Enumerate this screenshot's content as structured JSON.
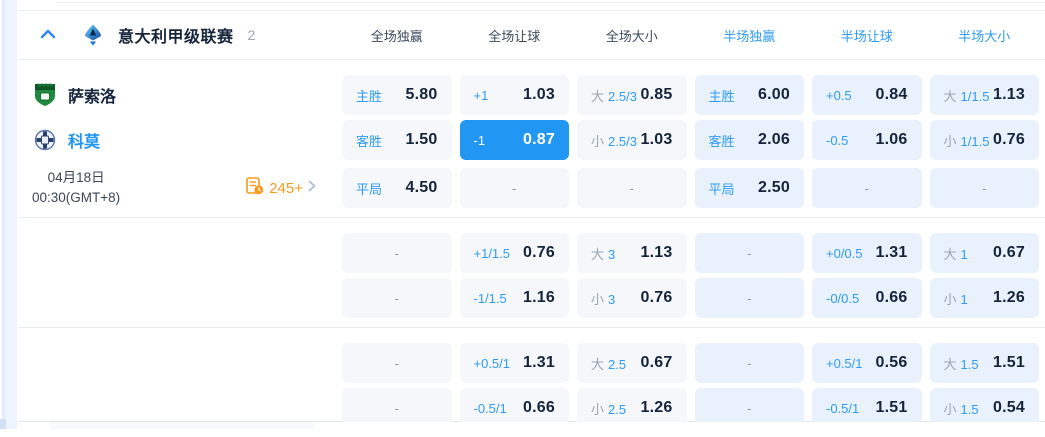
{
  "colors": {
    "accent_blue": "#2196f3",
    "label_blue": "#2f9bf4",
    "full_cell_bg": "#f5f7fa",
    "half_cell_bg": "#e9f2fc",
    "markets_orange": "#f89a1e",
    "value_dark": "#15243b"
  },
  "header": {
    "league": "意大利甲级联赛",
    "count": "2",
    "columns": [
      {
        "label": "全场独赢",
        "scope": "full"
      },
      {
        "label": "全场让球",
        "scope": "full"
      },
      {
        "label": "全场大小",
        "scope": "full"
      },
      {
        "label": "半场独赢",
        "scope": "half"
      },
      {
        "label": "半场让球",
        "scope": "half"
      },
      {
        "label": "半场大小",
        "scope": "half"
      }
    ]
  },
  "match": {
    "home": "萨索洛",
    "away": "科莫",
    "date_line1": "04月18日",
    "date_line2": "00:30(GMT+8)",
    "more_markets": "245+"
  },
  "odds": {
    "groups": [
      {
        "rows": [
          [
            {
              "t": "odds",
              "label": "主胜",
              "value": "5.80"
            },
            {
              "t": "odds",
              "label": "+1",
              "value": "1.03"
            },
            {
              "t": "ou",
              "side": "大",
              "line": "2.5/3",
              "value": "0.85"
            },
            {
              "t": "odds",
              "label": "主胜",
              "value": "6.00"
            },
            {
              "t": "odds",
              "label": "+0.5",
              "value": "0.84"
            },
            {
              "t": "ou",
              "side": "大",
              "line": "1/1.5",
              "value": "1.13"
            }
          ],
          [
            {
              "t": "odds",
              "label": "客胜",
              "value": "1.50"
            },
            {
              "t": "odds",
              "label": "-1",
              "value": "0.87",
              "hl": true
            },
            {
              "t": "ou",
              "side": "小",
              "line": "2.5/3",
              "value": "1.03"
            },
            {
              "t": "odds",
              "label": "客胜",
              "value": "2.06"
            },
            {
              "t": "odds",
              "label": "-0.5",
              "value": "1.06"
            },
            {
              "t": "ou",
              "side": "小",
              "line": "1/1.5",
              "value": "0.76"
            }
          ],
          [
            {
              "t": "odds",
              "label": "平局",
              "value": "4.50"
            },
            {
              "t": "dash"
            },
            {
              "t": "dash"
            },
            {
              "t": "odds",
              "label": "平局",
              "value": "2.50"
            },
            {
              "t": "dash"
            },
            {
              "t": "dash"
            }
          ]
        ]
      },
      {
        "rows": [
          [
            {
              "t": "dash"
            },
            {
              "t": "odds",
              "label": "+1/1.5",
              "value": "0.76"
            },
            {
              "t": "ou",
              "side": "大",
              "line": "3",
              "value": "1.13"
            },
            {
              "t": "dash"
            },
            {
              "t": "odds",
              "label": "+0/0.5",
              "value": "1.31"
            },
            {
              "t": "ou",
              "side": "大",
              "line": "1",
              "value": "0.67"
            }
          ],
          [
            {
              "t": "dash"
            },
            {
              "t": "odds",
              "label": "-1/1.5",
              "value": "1.16"
            },
            {
              "t": "ou",
              "side": "小",
              "line": "3",
              "value": "0.76"
            },
            {
              "t": "dash"
            },
            {
              "t": "odds",
              "label": "-0/0.5",
              "value": "0.66"
            },
            {
              "t": "ou",
              "side": "小",
              "line": "1",
              "value": "1.26"
            }
          ]
        ]
      },
      {
        "rows": [
          [
            {
              "t": "dash"
            },
            {
              "t": "odds",
              "label": "+0.5/1",
              "value": "1.31"
            },
            {
              "t": "ou",
              "side": "大",
              "line": "2.5",
              "value": "0.67"
            },
            {
              "t": "dash"
            },
            {
              "t": "odds",
              "label": "+0.5/1",
              "value": "0.56"
            },
            {
              "t": "ou",
              "side": "大",
              "line": "1.5",
              "value": "1.51"
            }
          ],
          [
            {
              "t": "dash"
            },
            {
              "t": "odds",
              "label": "-0.5/1",
              "value": "0.66"
            },
            {
              "t": "ou",
              "side": "小",
              "line": "2.5",
              "value": "1.26"
            },
            {
              "t": "dash"
            },
            {
              "t": "odds",
              "label": "-0.5/1",
              "value": "1.51"
            },
            {
              "t": "ou",
              "side": "小",
              "line": "1.5",
              "value": "0.54"
            }
          ]
        ]
      }
    ]
  }
}
